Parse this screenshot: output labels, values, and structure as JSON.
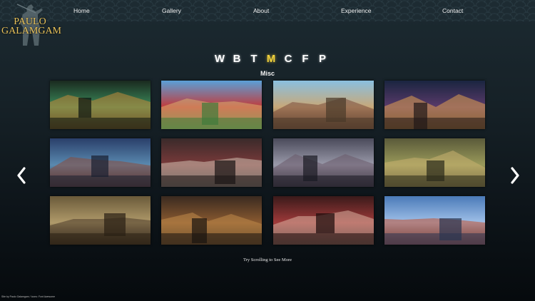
{
  "logo": {
    "line1": "PAULO",
    "line2": "GALAMGAM"
  },
  "nav": [
    {
      "label": "Home"
    },
    {
      "label": "Gallery"
    },
    {
      "label": "About"
    },
    {
      "label": "Experience"
    },
    {
      "label": "Contact"
    }
  ],
  "categories": [
    "W",
    "B",
    "T",
    "M",
    "C",
    "F",
    "P"
  ],
  "active_category": "M",
  "category_title": "Misc",
  "gallery": {
    "thumbnails": [
      {
        "name": "thumb-green-tavern-interior",
        "palette": [
          "#1a2a1f",
          "#3b8a5a",
          "#c58a3a",
          "#0b1410"
        ]
      },
      {
        "name": "thumb-red-roof-village",
        "palette": [
          "#5aa0d8",
          "#c23a3a",
          "#d9b070",
          "#3f7a3a"
        ]
      },
      {
        "name": "thumb-desert-market-street",
        "palette": [
          "#8ac0e0",
          "#c8a878",
          "#7a4a3a",
          "#4a3a2a"
        ]
      },
      {
        "name": "thumb-night-town-street",
        "palette": [
          "#1a2540",
          "#5a3a6a",
          "#e0a050",
          "#201818"
        ]
      },
      {
        "name": "thumb-swamp-house",
        "palette": [
          "#2a3f6a",
          "#5a8ab0",
          "#8a4a3a",
          "#1a2030"
        ]
      },
      {
        "name": "thumb-red-temple-hall",
        "palette": [
          "#3a2a2a",
          "#7a3a3a",
          "#d0c0b0",
          "#1a1414"
        ]
      },
      {
        "name": "thumb-snowy-gate",
        "palette": [
          "#4a4a5a",
          "#9a9aaa",
          "#6a5a6a",
          "#1a1a22"
        ]
      },
      {
        "name": "thumb-jungle-ruins",
        "palette": [
          "#5a5a3a",
          "#9a9a5a",
          "#c8b070",
          "#2a2a1a"
        ]
      },
      {
        "name": "thumb-desert-fortress",
        "palette": [
          "#6a5a3a",
          "#b09a6a",
          "#4a3a2a",
          "#2a2014"
        ]
      },
      {
        "name": "thumb-workshop-interior",
        "palette": [
          "#3a2a20",
          "#8a5a30",
          "#c08a4a",
          "#1a1410"
        ]
      },
      {
        "name": "thumb-red-canyon",
        "palette": [
          "#3a1a1a",
          "#a03a3a",
          "#d8b0a0",
          "#1a0a0a"
        ]
      },
      {
        "name": "thumb-blue-mountain-pass",
        "palette": [
          "#4a7ab8",
          "#a0c0e8",
          "#c05030",
          "#2a3450"
        ]
      }
    ]
  },
  "hint": "Try Scrolling to See More",
  "credit": "Site by Paulo Galamgam / Icons: Font Awesome"
}
